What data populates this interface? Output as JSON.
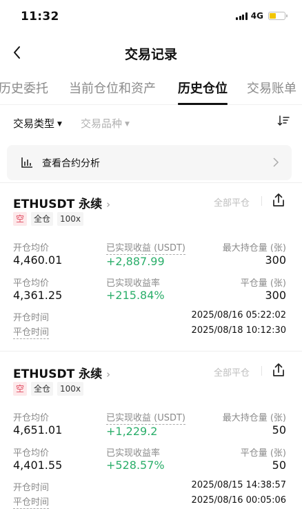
{
  "status": {
    "time": "11:32",
    "network": "4G",
    "battery_color": "#f2c500",
    "battery_level": 0.45
  },
  "nav": {
    "title": "交易记录",
    "back_icon": "chevron-left-icon"
  },
  "tabs": [
    {
      "label": "历史委托",
      "active": false
    },
    {
      "label": "当前仓位和资产",
      "active": false
    },
    {
      "label": "历史仓位",
      "active": true
    },
    {
      "label": "交易账单",
      "active": false
    }
  ],
  "filters": {
    "trade_type": "交易类型",
    "trade_symbol": "交易品种",
    "sort_icon": "sort-icon"
  },
  "analysis": {
    "label": "查看合约分析",
    "icon": "bar-chart-icon"
  },
  "colors": {
    "profit_green": "#2bae6a",
    "short_red": "#e04a5f"
  },
  "positions": [
    {
      "title": "ETHUSDT 永续",
      "title_chevron": "›",
      "close_all": "全部平仓",
      "tags": [
        "空",
        "全仓",
        "100x"
      ],
      "open_avg_label": "开仓均价",
      "open_avg": "4,460.01",
      "realized_pnl_label": "已实现收益 (USDT)",
      "realized_pnl": "+2,887.99",
      "max_hold_label": "最大持仓量 (张)",
      "max_hold": "300",
      "close_avg_label": "平仓均价",
      "close_avg": "4,361.25",
      "realized_rate_label": "已实现收益率",
      "realized_rate": "+215.84%",
      "close_qty_label": "平仓量 (张)",
      "close_qty": "300",
      "open_time_label": "开仓时间",
      "open_time": "2025/08/16 05:22:02",
      "close_time_label": "平仓时间",
      "close_time": "2025/08/18 10:12:30"
    },
    {
      "title": "ETHUSDT 永续",
      "title_chevron": "›",
      "close_all": "全部平仓",
      "tags": [
        "空",
        "全仓",
        "100x"
      ],
      "open_avg_label": "开仓均价",
      "open_avg": "4,651.01",
      "realized_pnl_label": "已实现收益 (USDT)",
      "realized_pnl": "+1,229.2",
      "max_hold_label": "最大持仓量 (张)",
      "max_hold": "50",
      "close_avg_label": "平仓均价",
      "close_avg": "4,401.55",
      "realized_rate_label": "已实现收益率",
      "realized_rate": "+528.57%",
      "close_qty_label": "平仓量 (张)",
      "close_qty": "50",
      "open_time_label": "开仓时间",
      "open_time": "2025/08/15 14:38:57",
      "close_time_label": "平仓时间",
      "close_time": "2025/08/16 00:05:06"
    }
  ]
}
